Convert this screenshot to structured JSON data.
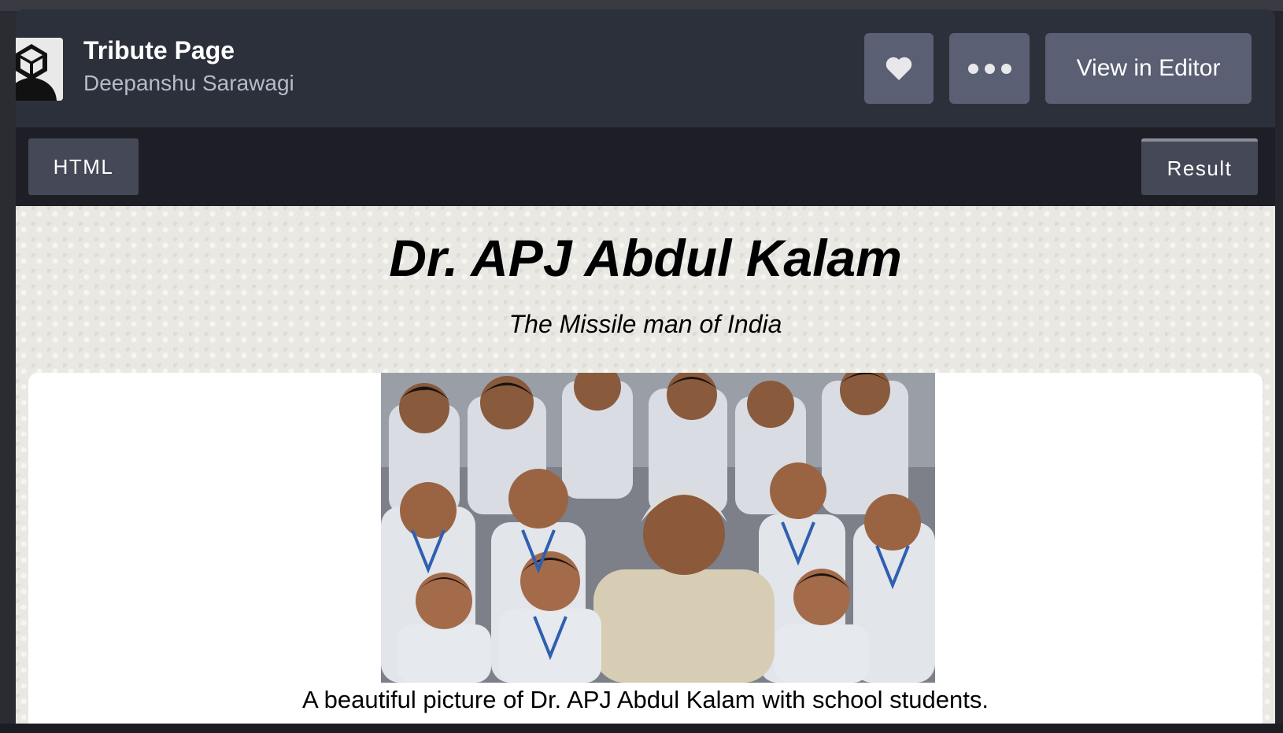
{
  "header": {
    "title": "Tribute Page",
    "author": "Deepanshu Sarawagi",
    "view_in_editor_label": "View in Editor"
  },
  "tabs": {
    "html_label": "HTML",
    "result_label": "Result"
  },
  "result": {
    "heading": "Dr. APJ Abdul Kalam",
    "subtitle": "The Missile man of India",
    "caption": "A beautiful picture of Dr. APJ Abdul Kalam with school students."
  },
  "icons": {
    "heart": "heart-icon",
    "more": "more-dots-icon",
    "avatar": "codepen-avatar"
  },
  "colors": {
    "header_bg": "#2c303a",
    "button_bg": "#5a5f73",
    "tabbar_bg": "#1e1f26",
    "tab_bg": "#444857",
    "result_bg": "#e9e8e3"
  }
}
